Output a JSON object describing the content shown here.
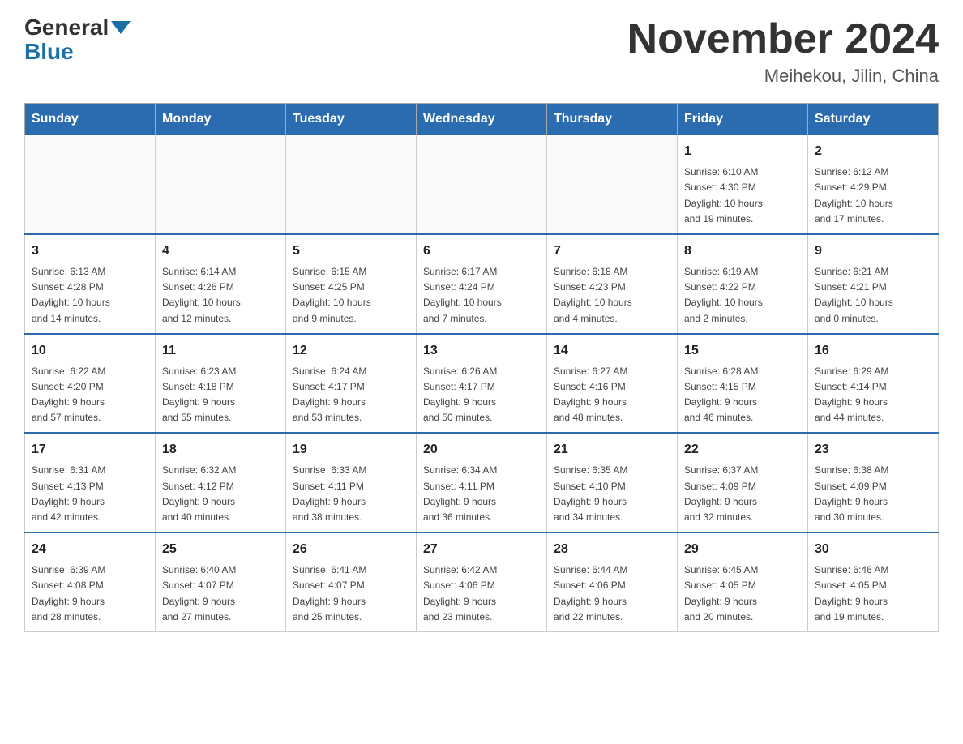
{
  "header": {
    "logo_general": "General",
    "logo_blue": "Blue",
    "month_title": "November 2024",
    "location": "Meihekou, Jilin, China"
  },
  "days_of_week": [
    "Sunday",
    "Monday",
    "Tuesday",
    "Wednesday",
    "Thursday",
    "Friday",
    "Saturday"
  ],
  "weeks": [
    [
      {
        "day": "",
        "info": ""
      },
      {
        "day": "",
        "info": ""
      },
      {
        "day": "",
        "info": ""
      },
      {
        "day": "",
        "info": ""
      },
      {
        "day": "",
        "info": ""
      },
      {
        "day": "1",
        "info": "Sunrise: 6:10 AM\nSunset: 4:30 PM\nDaylight: 10 hours\nand 19 minutes."
      },
      {
        "day": "2",
        "info": "Sunrise: 6:12 AM\nSunset: 4:29 PM\nDaylight: 10 hours\nand 17 minutes."
      }
    ],
    [
      {
        "day": "3",
        "info": "Sunrise: 6:13 AM\nSunset: 4:28 PM\nDaylight: 10 hours\nand 14 minutes."
      },
      {
        "day": "4",
        "info": "Sunrise: 6:14 AM\nSunset: 4:26 PM\nDaylight: 10 hours\nand 12 minutes."
      },
      {
        "day": "5",
        "info": "Sunrise: 6:15 AM\nSunset: 4:25 PM\nDaylight: 10 hours\nand 9 minutes."
      },
      {
        "day": "6",
        "info": "Sunrise: 6:17 AM\nSunset: 4:24 PM\nDaylight: 10 hours\nand 7 minutes."
      },
      {
        "day": "7",
        "info": "Sunrise: 6:18 AM\nSunset: 4:23 PM\nDaylight: 10 hours\nand 4 minutes."
      },
      {
        "day": "8",
        "info": "Sunrise: 6:19 AM\nSunset: 4:22 PM\nDaylight: 10 hours\nand 2 minutes."
      },
      {
        "day": "9",
        "info": "Sunrise: 6:21 AM\nSunset: 4:21 PM\nDaylight: 10 hours\nand 0 minutes."
      }
    ],
    [
      {
        "day": "10",
        "info": "Sunrise: 6:22 AM\nSunset: 4:20 PM\nDaylight: 9 hours\nand 57 minutes."
      },
      {
        "day": "11",
        "info": "Sunrise: 6:23 AM\nSunset: 4:18 PM\nDaylight: 9 hours\nand 55 minutes."
      },
      {
        "day": "12",
        "info": "Sunrise: 6:24 AM\nSunset: 4:17 PM\nDaylight: 9 hours\nand 53 minutes."
      },
      {
        "day": "13",
        "info": "Sunrise: 6:26 AM\nSunset: 4:17 PM\nDaylight: 9 hours\nand 50 minutes."
      },
      {
        "day": "14",
        "info": "Sunrise: 6:27 AM\nSunset: 4:16 PM\nDaylight: 9 hours\nand 48 minutes."
      },
      {
        "day": "15",
        "info": "Sunrise: 6:28 AM\nSunset: 4:15 PM\nDaylight: 9 hours\nand 46 minutes."
      },
      {
        "day": "16",
        "info": "Sunrise: 6:29 AM\nSunset: 4:14 PM\nDaylight: 9 hours\nand 44 minutes."
      }
    ],
    [
      {
        "day": "17",
        "info": "Sunrise: 6:31 AM\nSunset: 4:13 PM\nDaylight: 9 hours\nand 42 minutes."
      },
      {
        "day": "18",
        "info": "Sunrise: 6:32 AM\nSunset: 4:12 PM\nDaylight: 9 hours\nand 40 minutes."
      },
      {
        "day": "19",
        "info": "Sunrise: 6:33 AM\nSunset: 4:11 PM\nDaylight: 9 hours\nand 38 minutes."
      },
      {
        "day": "20",
        "info": "Sunrise: 6:34 AM\nSunset: 4:11 PM\nDaylight: 9 hours\nand 36 minutes."
      },
      {
        "day": "21",
        "info": "Sunrise: 6:35 AM\nSunset: 4:10 PM\nDaylight: 9 hours\nand 34 minutes."
      },
      {
        "day": "22",
        "info": "Sunrise: 6:37 AM\nSunset: 4:09 PM\nDaylight: 9 hours\nand 32 minutes."
      },
      {
        "day": "23",
        "info": "Sunrise: 6:38 AM\nSunset: 4:09 PM\nDaylight: 9 hours\nand 30 minutes."
      }
    ],
    [
      {
        "day": "24",
        "info": "Sunrise: 6:39 AM\nSunset: 4:08 PM\nDaylight: 9 hours\nand 28 minutes."
      },
      {
        "day": "25",
        "info": "Sunrise: 6:40 AM\nSunset: 4:07 PM\nDaylight: 9 hours\nand 27 minutes."
      },
      {
        "day": "26",
        "info": "Sunrise: 6:41 AM\nSunset: 4:07 PM\nDaylight: 9 hours\nand 25 minutes."
      },
      {
        "day": "27",
        "info": "Sunrise: 6:42 AM\nSunset: 4:06 PM\nDaylight: 9 hours\nand 23 minutes."
      },
      {
        "day": "28",
        "info": "Sunrise: 6:44 AM\nSunset: 4:06 PM\nDaylight: 9 hours\nand 22 minutes."
      },
      {
        "day": "29",
        "info": "Sunrise: 6:45 AM\nSunset: 4:05 PM\nDaylight: 9 hours\nand 20 minutes."
      },
      {
        "day": "30",
        "info": "Sunrise: 6:46 AM\nSunset: 4:05 PM\nDaylight: 9 hours\nand 19 minutes."
      }
    ]
  ]
}
